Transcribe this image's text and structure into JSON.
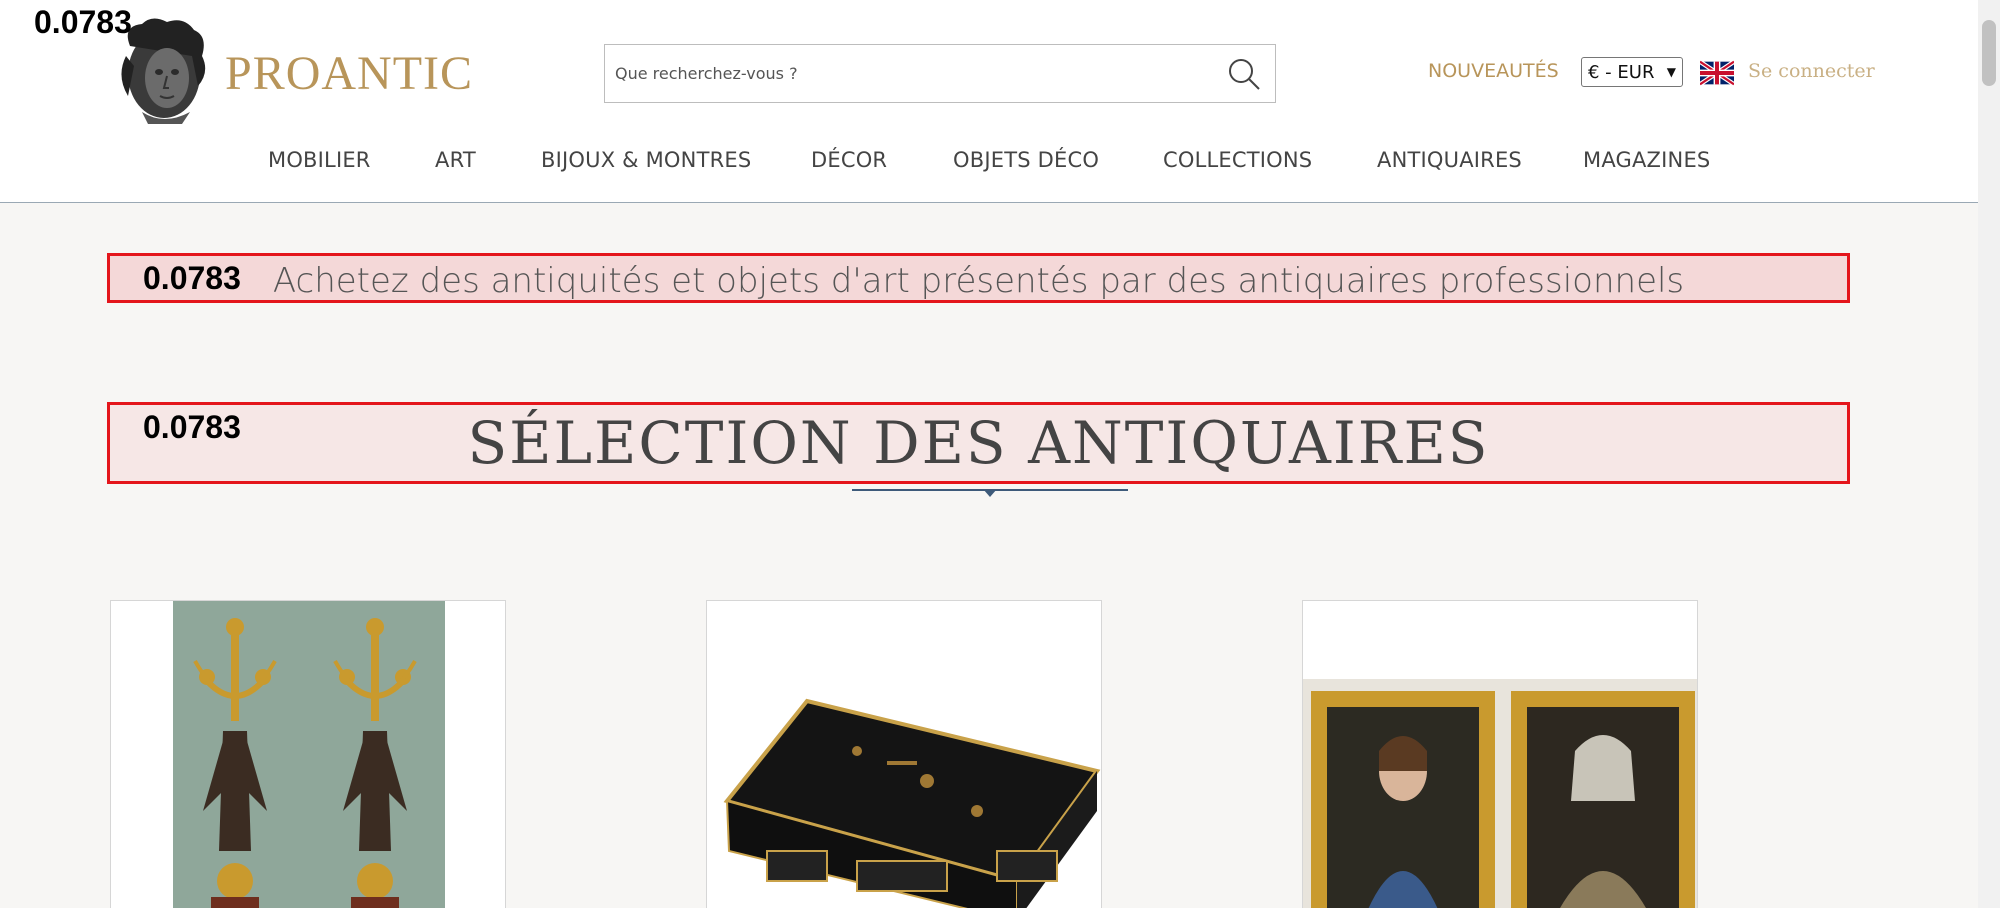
{
  "overlay_metric": "0.0783",
  "header": {
    "brand": "PROANTIC",
    "search_placeholder": "Que recherchez-vous ?",
    "nouveautes": "NOUVEAUTÉS",
    "currency": "€ - EUR",
    "language_flag": "uk-flag-icon",
    "login": "Se connecter"
  },
  "nav": {
    "items": [
      "MOBILIER",
      "ART",
      "BIJOUX & MONTRES",
      "DÉCOR",
      "OBJETS DÉCO",
      "COLLECTIONS",
      "ANTIQUAIRES",
      "MAGAZINES"
    ]
  },
  "tagline": {
    "metric": "0.0783",
    "text": "Achetez des antiquités et objets d'art présentés par des antiquaires professionnels"
  },
  "section": {
    "metric": "0.0783",
    "title": "SÉLECTION DES ANTIQUAIRES"
  },
  "products": [
    {
      "image": "candelabra-pair-image"
    },
    {
      "image": "chinoiserie-desk-image"
    },
    {
      "image": "portrait-pair-image"
    }
  ],
  "colors": {
    "brand_gold": "#b8955a",
    "highlight_red": "#e4151b",
    "accent_navy": "#3d5a7a"
  }
}
